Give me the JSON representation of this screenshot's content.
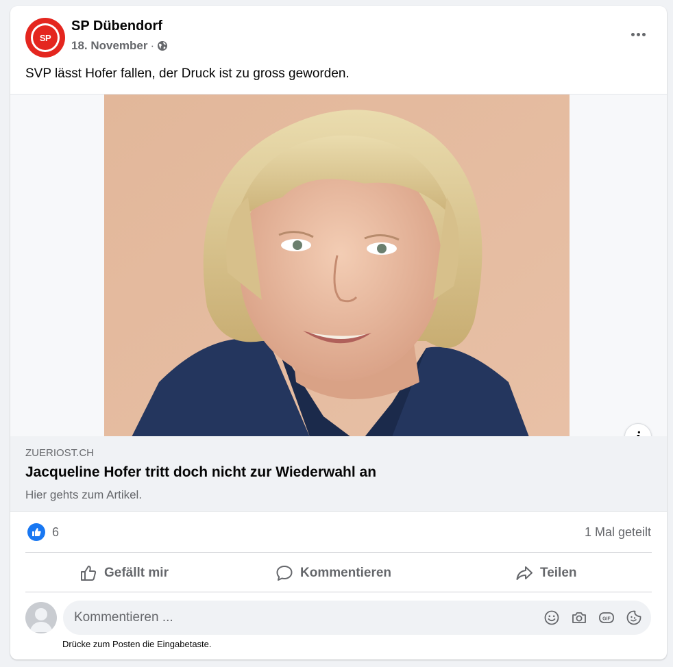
{
  "post": {
    "page_name": "SP Dübendorf",
    "avatar_text": "SP",
    "date": "18. November",
    "separator": "·",
    "text": "SVP lässt Hofer fallen, der Druck ist zu gross geworden."
  },
  "link": {
    "domain": "ZUERIOST.CH",
    "title": "Jacqueline Hofer tritt doch nicht zur Wiederwahl an",
    "description": "Hier gehts zum Artikel.",
    "info_label": "i"
  },
  "stats": {
    "like_count": "6",
    "shares": "1 Mal geteilt"
  },
  "actions": {
    "like": "Gefällt mir",
    "comment": "Kommentieren",
    "share": "Teilen"
  },
  "comment": {
    "placeholder": "Kommentieren ...",
    "hint": "Drücke zum Posten die Eingabetaste."
  },
  "icons": {
    "globe": "globe-icon",
    "more": "more-options-icon",
    "like": "thumbs-up-icon",
    "comment": "speech-bubble-icon",
    "share": "share-arrow-icon",
    "emoji": "emoji-icon",
    "camera": "camera-icon",
    "gif": "gif-icon",
    "sticker": "sticker-icon"
  },
  "colors": {
    "brand_red": "#e4261f",
    "facebook_blue": "#1877f2",
    "secondary_text": "#65676b"
  }
}
